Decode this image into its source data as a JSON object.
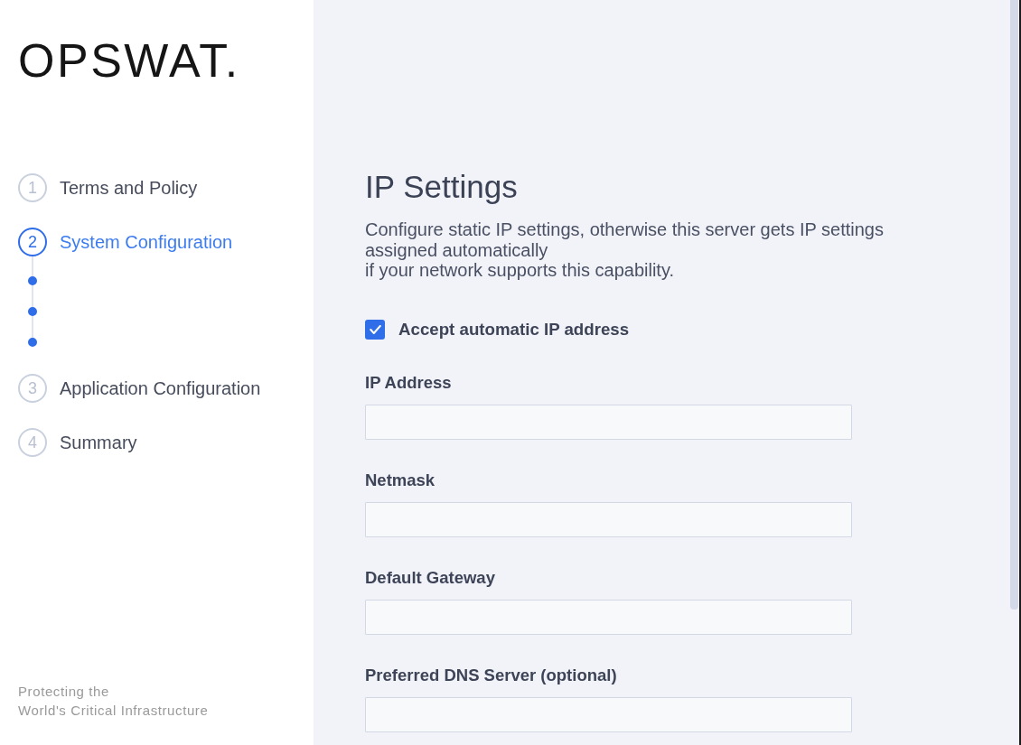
{
  "sidebar": {
    "logo": "OPSWAT.",
    "steps": [
      {
        "number": "1",
        "label": "Terms and Policy",
        "selected": false
      },
      {
        "number": "2",
        "label": "System Configuration",
        "selected": true,
        "substeps": [
          {
            "done": true
          },
          {
            "done": true
          },
          {
            "done": true
          }
        ]
      },
      {
        "number": "3",
        "label": "Application Configuration",
        "selected": false
      },
      {
        "number": "4",
        "label": "Summary",
        "selected": false
      }
    ],
    "tagline": "Protecting the\nWorld's Critical Infrastructure"
  },
  "main": {
    "title": "IP Settings",
    "description": "Configure static IP settings, otherwise this server gets IP settings\nassigned automatically\nif your network supports this capability.",
    "auto_ip": {
      "label": "Accept automatic IP address",
      "checked": true
    },
    "fields": [
      {
        "label": "IP Address"
      },
      {
        "label": "Netmask"
      },
      {
        "label": "Default Gateway"
      },
      {
        "label": "Preferred DNS Server (optional)"
      }
    ]
  }
}
